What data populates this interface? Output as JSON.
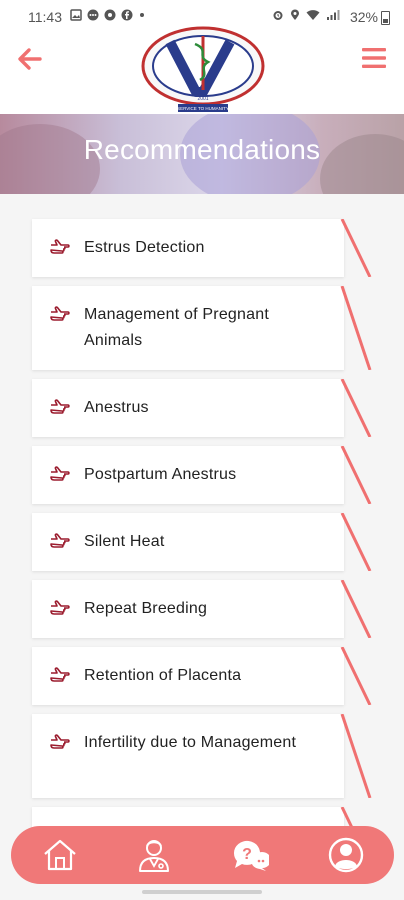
{
  "status_bar": {
    "time": "11:43",
    "battery": "32%",
    "left_icons": [
      "image-icon",
      "dots-icon",
      "record-icon",
      "facebook-icon",
      "dot-icon"
    ],
    "right_icons": [
      "alarm-icon",
      "location-icon",
      "wifi-icon",
      "signal-icon"
    ]
  },
  "header": {
    "back_icon": "arrow-left-icon",
    "menu_icon": "hamburger-icon",
    "logo_text": "SERVICE TO HUMANITY",
    "logo_year": "2001",
    "accent_color": "#f07070"
  },
  "banner": {
    "title": "Recommendations"
  },
  "recommendations": [
    {
      "label": "Estrus Detection"
    },
    {
      "label": "Management of Pregnant Animals"
    },
    {
      "label": "Anestrus"
    },
    {
      "label": "Postpartum Anestrus"
    },
    {
      "label": "Silent Heat"
    },
    {
      "label": "Repeat Breeding"
    },
    {
      "label": "Retention of Placenta"
    },
    {
      "label": "Infertility due to Management"
    }
  ],
  "bottom_nav": {
    "color": "#f07878",
    "items": [
      "home-icon",
      "doctor-icon",
      "help-chat-icon",
      "profile-icon"
    ]
  }
}
